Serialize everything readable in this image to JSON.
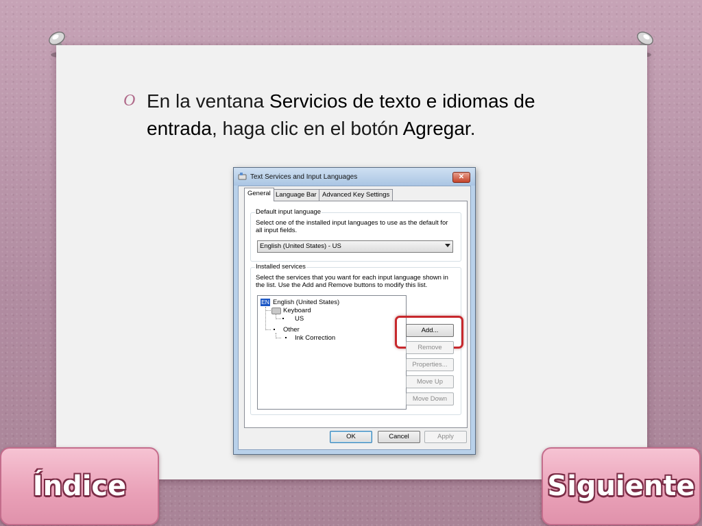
{
  "slide": {
    "bullet_mark": "O",
    "text_before": "En la ventana ",
    "text_bold1": "Servicios de texto e idiomas de entrada",
    "text_middle": ", haga clic en el botón ",
    "text_bold2": "Agregar",
    "text_after": "."
  },
  "dialog": {
    "title": "Text Services and Input Languages",
    "close_label": "✕",
    "tabs": [
      "General",
      "Language Bar",
      "Advanced Key Settings"
    ],
    "default_group": {
      "label": "Default input language",
      "desc": "Select one of the installed input languages to use as the default for all input fields.",
      "selected": "English (United States) - US"
    },
    "services_group": {
      "label": "Installed services",
      "desc": "Select the services that you want for each input language shown in the list. Use the Add and Remove buttons to modify this list."
    },
    "tree": {
      "badge": "EN",
      "language": "English (United States)",
      "keyboard": "Keyboard",
      "us": "US",
      "other": "Other",
      "ink": "Ink Correction"
    },
    "side_buttons": {
      "add": "Add...",
      "remove": "Remove",
      "properties": "Properties...",
      "move_up": "Move Up",
      "move_down": "Move Down"
    },
    "footer": {
      "ok": "OK",
      "cancel": "Cancel",
      "apply": "Apply"
    }
  },
  "nav": {
    "index": "Índice",
    "next": "Siguiente"
  },
  "colors": {
    "highlight": "#c7282c",
    "nav_pink": "#e9a0b7",
    "accent": "#b06a8a"
  }
}
